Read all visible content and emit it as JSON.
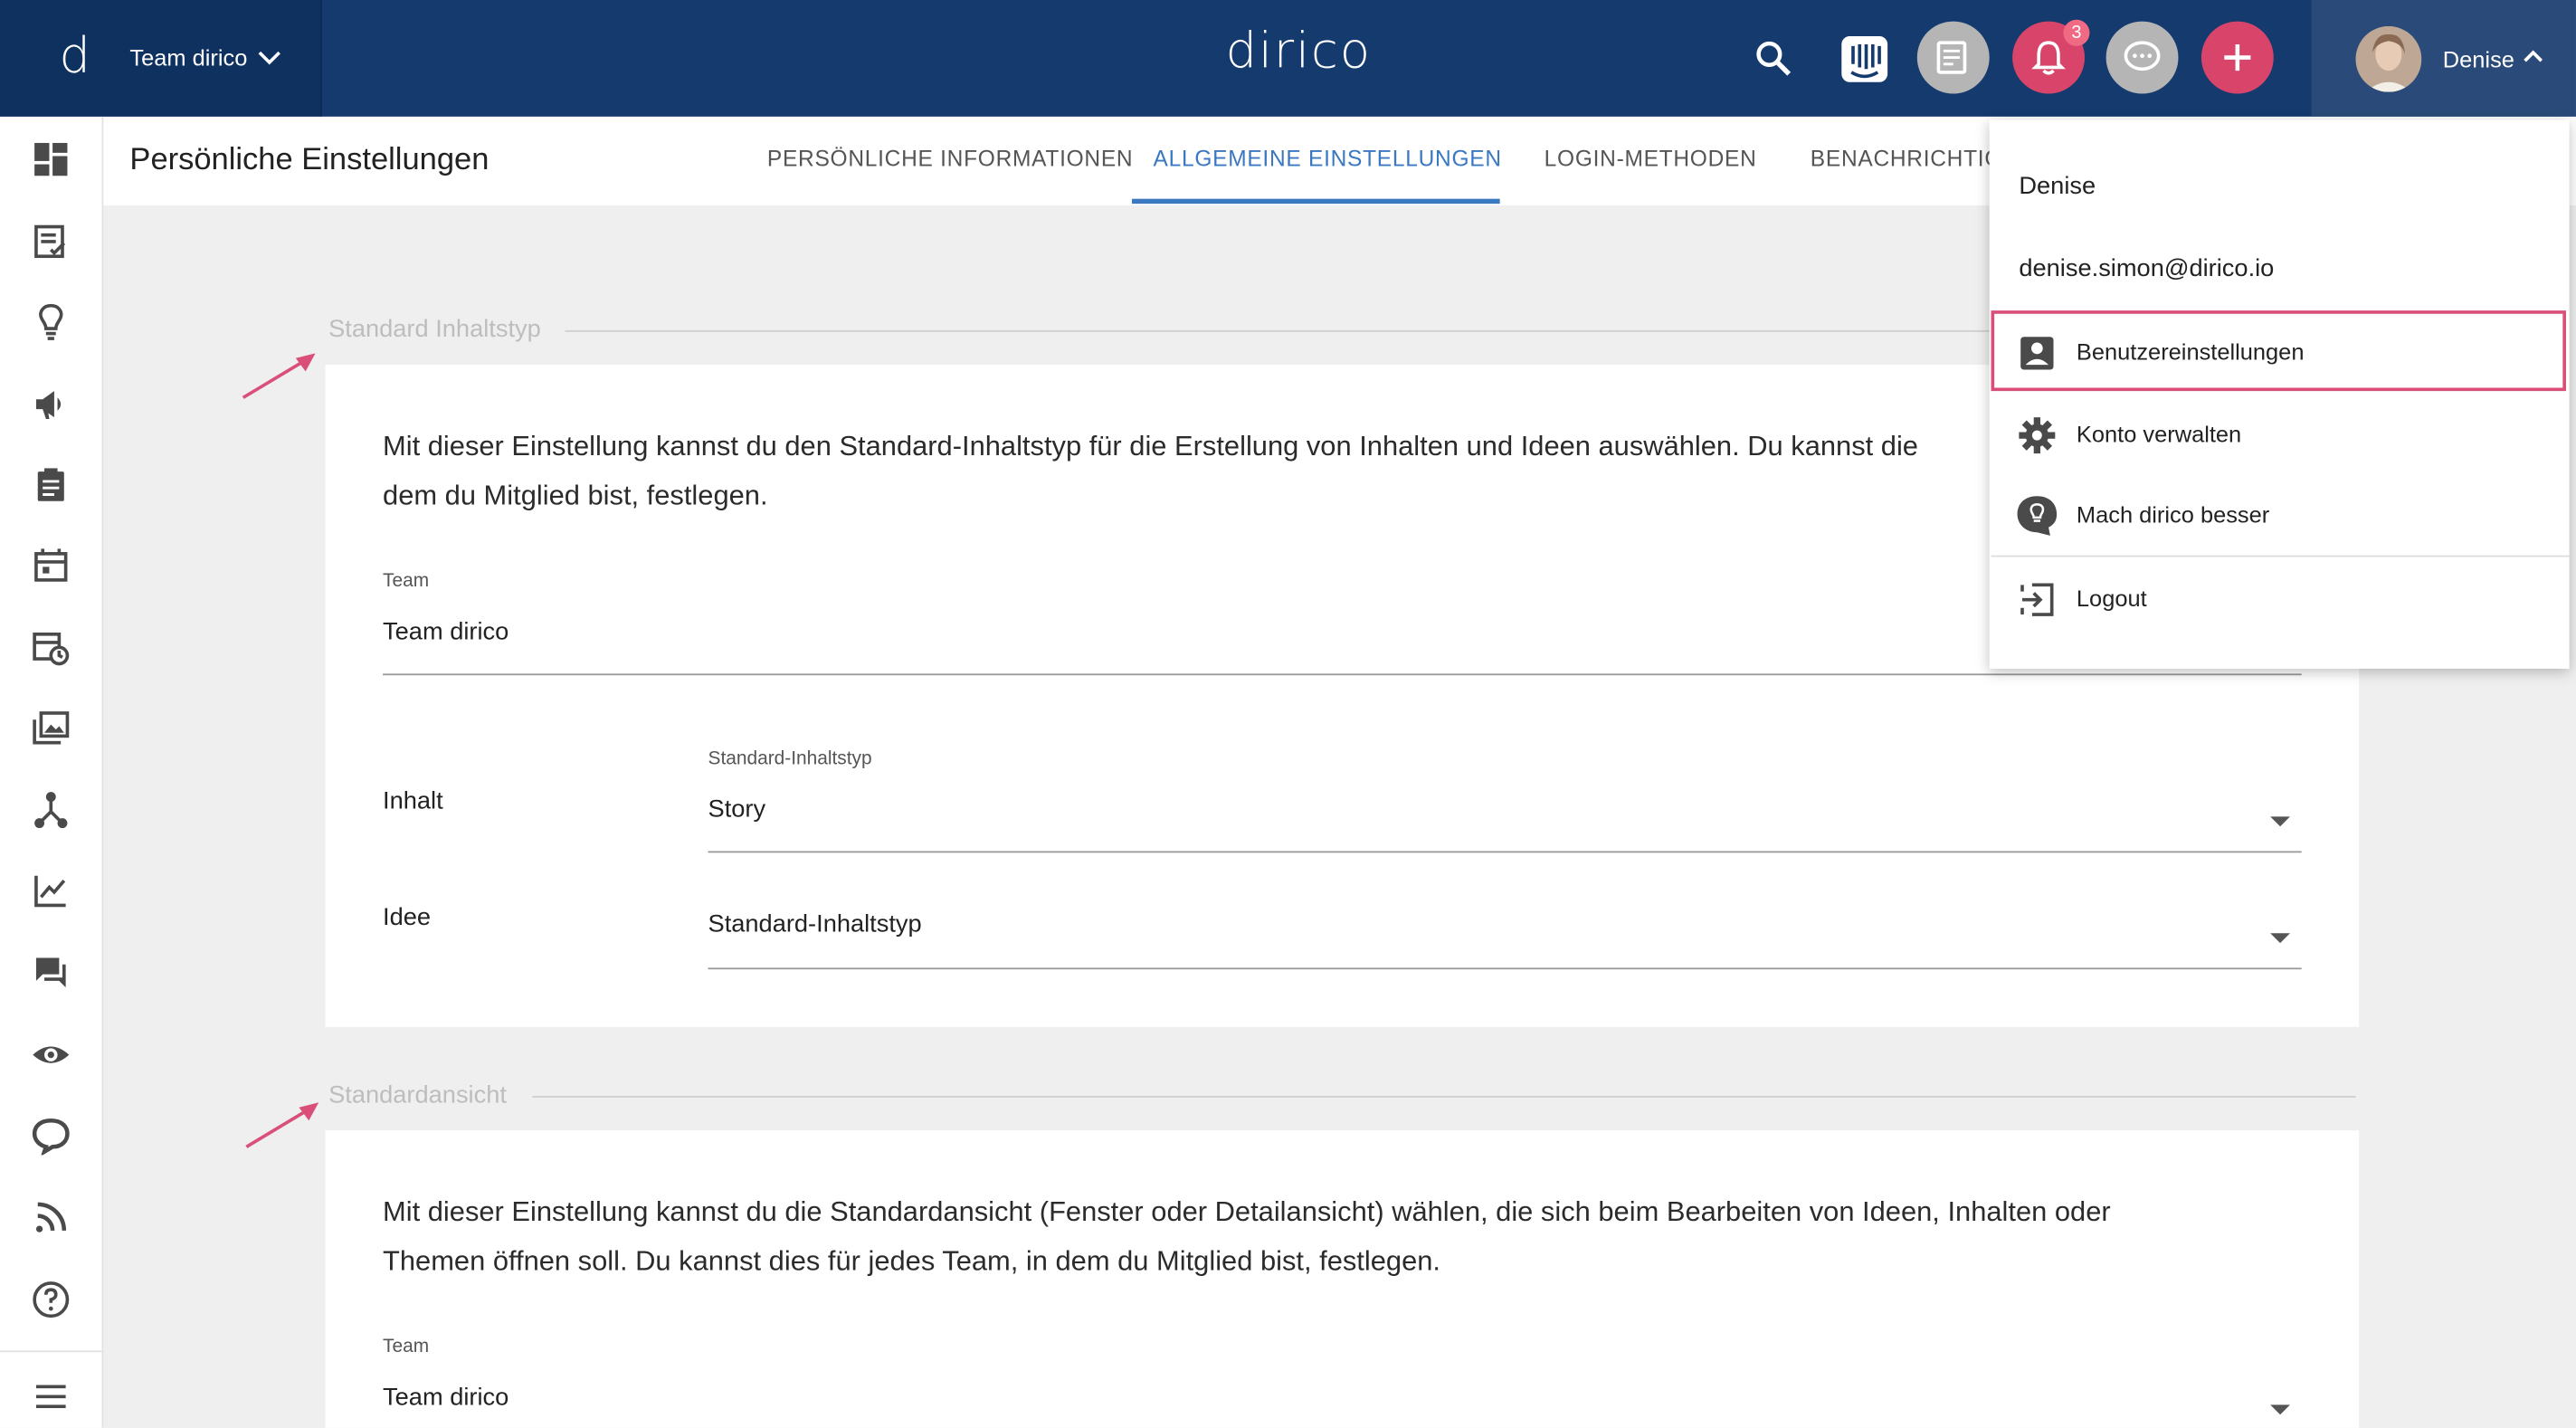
{
  "topbar": {
    "team_label": "Team dirico",
    "brand": "dirico",
    "notification_count": "3",
    "user_name": "Denise"
  },
  "page": {
    "title": "Persönliche Einstellungen"
  },
  "tabs": [
    {
      "label": "PERSÖNLICHE INFORMATIONEN",
      "active": false
    },
    {
      "label": "ALLGEMEINE EINSTELLUNGEN",
      "active": true
    },
    {
      "label": "LOGIN-METHODEN",
      "active": false
    },
    {
      "label": "BENACHRICHTIG",
      "active": false
    }
  ],
  "section1": {
    "title": "Standard Inhaltstyp",
    "description": "Mit dieser Einstellung kannst du den Standard-Inhaltstyp für die Erstellung von Inhalten und Ideen auswählen. Du kannst die",
    "description_line2": "dem du Mitglied bist, festlegen.",
    "team_label": "Team",
    "team_value": "Team dirico",
    "rows": [
      {
        "label": "Inhalt",
        "field_label": "Standard-Inhaltstyp",
        "value": "Story"
      },
      {
        "label": "Idee",
        "field_label": "",
        "value": "Standard-Inhaltstyp"
      }
    ]
  },
  "section2": {
    "title": "Standardansicht",
    "description": "Mit dieser Einstellung kannst du die Standardansicht (Fenster oder Detailansicht) wählen, die sich beim Bearbeiten von Ideen, Inhalten oder",
    "description_line2": "Themen öffnen soll. Du kannst dies für jedes Team, in dem du Mitglied bist, festlegen.",
    "team_label": "Team",
    "team_value": "Team dirico"
  },
  "user_menu": {
    "name": "Denise",
    "email": "denise.simon@dirico.io",
    "items": [
      {
        "label": "Benutzereinstellungen",
        "icon": "account-box-icon",
        "highlighted": true
      },
      {
        "label": "Konto verwalten",
        "icon": "gear-icon",
        "highlighted": false
      },
      {
        "label": "Mach dirico besser",
        "icon": "lightbulb-chat-icon",
        "highlighted": false
      },
      {
        "label": "Logout",
        "icon": "logout-icon",
        "highlighted": false
      }
    ]
  },
  "colors": {
    "topbar": "#143a6e",
    "accent": "#3a78c2",
    "notification": "#d9456a",
    "highlight_border": "#d94f7a"
  }
}
